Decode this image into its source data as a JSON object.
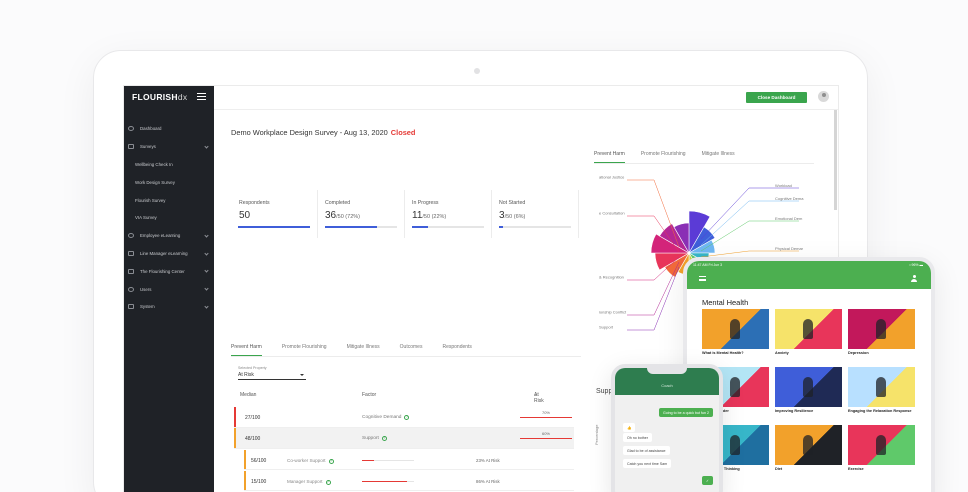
{
  "app": {
    "brand_bold": "FLOURISH",
    "brand_light": "dx",
    "close_button": "Close Dashboard"
  },
  "sidebar": {
    "items": [
      {
        "label": "Dashboard",
        "icon": "dashboard-icon"
      },
      {
        "label": "Surveys",
        "icon": "survey-icon",
        "expand": true
      },
      {
        "label": "Wellbeing Check In",
        "sub": true
      },
      {
        "label": "Work Design Survey",
        "sub": true
      },
      {
        "label": "Flourish Survey",
        "sub": true
      },
      {
        "label": "VIA Survey",
        "sub": true
      },
      {
        "label": "Employee eLearning",
        "icon": "elearning-icon",
        "expand": true
      },
      {
        "label": "Line Manager eLearning",
        "icon": "manager-icon",
        "expand": true
      },
      {
        "label": "The Flourishing Center",
        "icon": "center-icon",
        "expand": true
      },
      {
        "label": "Users",
        "icon": "users-icon",
        "expand": true
      },
      {
        "label": "System",
        "icon": "system-icon",
        "expand": true
      }
    ]
  },
  "survey": {
    "title": "Demo Workplace Design Survey - Aug 13, 2020",
    "status": "Closed"
  },
  "tabs_top": [
    "Prevent Harm",
    "Promote Flourishing",
    "Mitigate Illness"
  ],
  "stats": [
    {
      "label": "Respondents",
      "value": "50",
      "suffix": "",
      "fill": 1.0
    },
    {
      "label": "Completed",
      "value": "36",
      "suffix": "/50 (72%)",
      "fill": 0.72
    },
    {
      "label": "In Progress",
      "value": "11",
      "suffix": "/50 (22%)",
      "fill": 0.22
    },
    {
      "label": "Not Started",
      "value": "3",
      "suffix": "/50 (6%)",
      "fill": 0.06
    }
  ],
  "polar_labels_left": [
    "ational Justice",
    "e Consultation",
    "& Recognition",
    "ionship Conflict",
    "Support"
  ],
  "polar_labels_right": [
    "Workload",
    "Cognitive Dema",
    "Emotional Dem",
    "Physical Demar"
  ],
  "tabs_bottom": [
    "Prevent Harm",
    "Promote Flourishing",
    "Mitigate Illness",
    "Outcomes",
    "Respondents"
  ],
  "property": {
    "label": "Selected Property",
    "value": "At Risk"
  },
  "table": {
    "col_median": "Median",
    "col_factor": "Factor",
    "col_risk": "At Risk",
    "rows": [
      {
        "value": "27/100",
        "factor": "Cognitive Demand",
        "risk": "70%",
        "color": "#e53935"
      },
      {
        "value": "48/100",
        "factor": "Support",
        "risk": "60%",
        "color": "#f2a12b"
      }
    ],
    "subrows": [
      {
        "value": "56/100",
        "factor": "Co-worker Support",
        "pct": "23% At Risk",
        "fill": 0.23
      },
      {
        "value": "15/100",
        "factor": "Manager Support",
        "pct": "86% At Risk",
        "fill": 0.86
      }
    ]
  },
  "side_title": "Supp",
  "axis_label": "Percentage",
  "tablet": {
    "status_left": "11:47 AM   Fri Jun 3",
    "status_right": "• 96% ▬",
    "heading": "Mental Health",
    "cards": [
      "What is Mental Health?",
      "Anxiety",
      "Depression",
      "e Use Disorder",
      "Improving Resilience",
      "Engaging the Relaxation Response",
      "g Unhelpful Thinking",
      "Diet",
      "Exercise"
    ]
  },
  "phone": {
    "title": "Coach",
    "messages": [
      {
        "text": "Going to be a quick but fun 2",
        "out": true
      },
      {
        "text": "👍",
        "out": false
      },
      {
        "text": "Oh no bother",
        "out": false
      },
      {
        "text": "Glad to be of assistance",
        "out": false
      },
      {
        "text": "Catch you next time Sam",
        "out": false
      },
      {
        "text": "✓",
        "out": true
      }
    ]
  },
  "colors": {
    "sidebar": "#1f2227",
    "accent_green": "#3aa54d",
    "closed_red": "#e53935",
    "progress_blue": "#3f5ed9"
  }
}
